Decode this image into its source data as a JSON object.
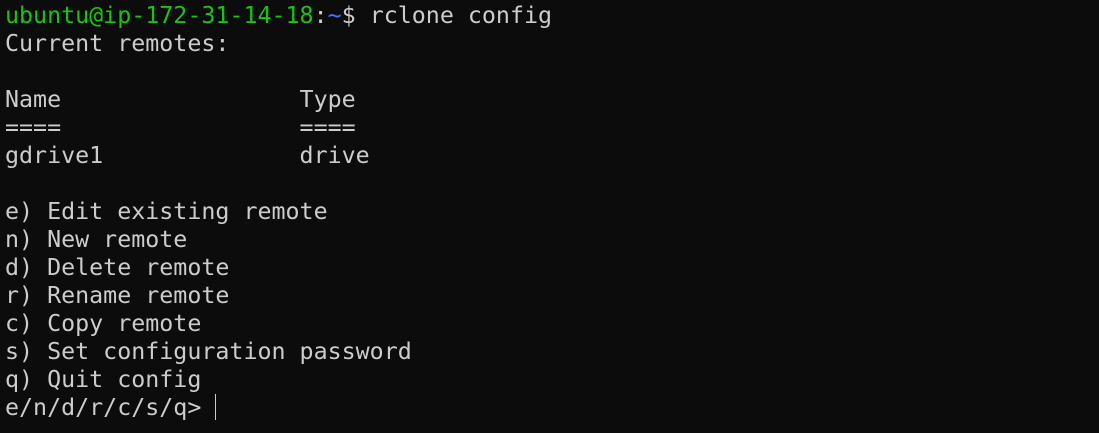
{
  "prompt": {
    "user_host": "ubuntu@ip-172-31-14-18",
    "separator": ":",
    "path": "~",
    "symbol": "$ ",
    "command": "rclone config"
  },
  "output": {
    "heading": "Current remotes:",
    "table": {
      "header": "Name                 Type",
      "rule": "====                 ====",
      "rows": [
        "gdrive1              drive"
      ]
    },
    "menu": [
      "e) Edit existing remote",
      "n) New remote",
      "d) Delete remote",
      "r) Rename remote",
      "c) Copy remote",
      "s) Set configuration password",
      "q) Quit config"
    ],
    "input_prompt": "e/n/d/r/c/s/q> "
  },
  "colors": {
    "background": "#0c0c0c",
    "foreground": "#cccccc",
    "user_host": "#16c60c",
    "path": "#3b78ff"
  }
}
